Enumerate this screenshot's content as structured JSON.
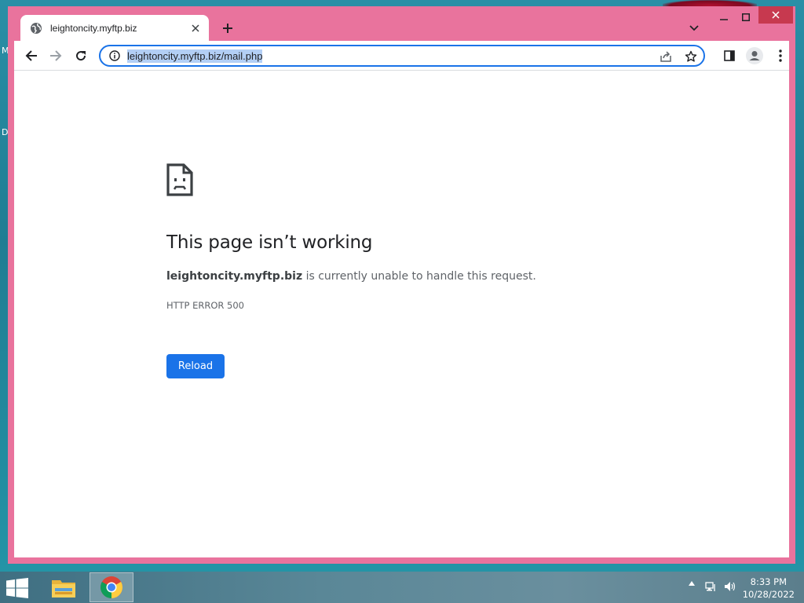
{
  "desktop": {
    "edge_letters": [
      "M",
      "D"
    ]
  },
  "browser": {
    "tab": {
      "title": "leightoncity.myftp.biz",
      "favicon": "globe-icon"
    },
    "address": {
      "url": "leightoncity.myftp.biz/mail.php",
      "selected": true
    },
    "accent": "#1a73e8",
    "frame_color": "#e9739d"
  },
  "error_page": {
    "icon": "sad-document-icon",
    "title": "This page isn’t working",
    "host": "leightoncity.myftp.biz",
    "message": " is currently unable to handle this request.",
    "code": "HTTP ERROR 500",
    "reload_label": "Reload"
  },
  "taskbar": {
    "apps": [
      "file-explorer-icon",
      "chrome-icon"
    ],
    "time": "8:33 PM",
    "date": "10/28/2022"
  }
}
